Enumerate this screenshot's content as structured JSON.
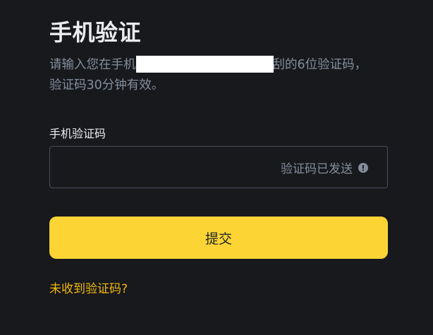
{
  "page": {
    "title": "手机验证",
    "description": {
      "line1_prefix": "请输入您在手机",
      "line1_suffix": "刮的6位验证码，",
      "line2": "验证码30分钟有效。"
    }
  },
  "form": {
    "code_label": "手机验证码",
    "code_value": "",
    "code_status": "验证码已发送",
    "status_icon": "info-circle-icon",
    "submit_label": "提交"
  },
  "footer": {
    "resend_link": "未收到验证码?"
  },
  "colors": {
    "background": "#18191d",
    "accent": "#fcd535",
    "link": "#f0b90b",
    "muted_text": "#848e9c",
    "primary_text": "#eaecef"
  }
}
